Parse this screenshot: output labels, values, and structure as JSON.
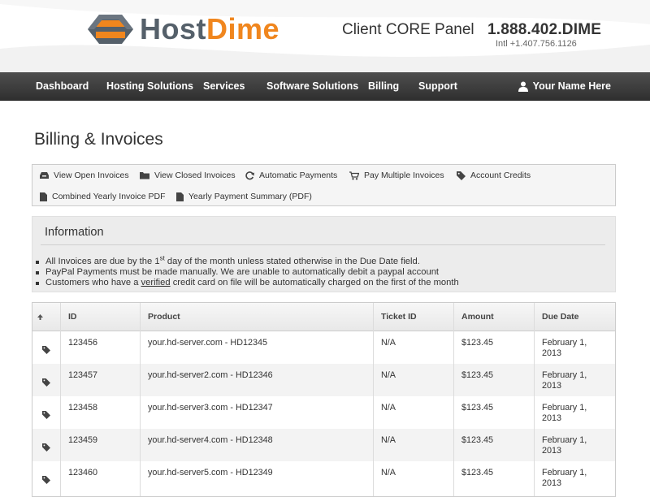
{
  "brand": {
    "name_part1": "Host",
    "name_part2": "Dime",
    "panel_title": "Client CORE Panel",
    "phone": "1.888.402.DIME",
    "phone_intl": "Intl +1.407.756.1126",
    "accent_color": "#f0861e",
    "logo_gray": "#55606a"
  },
  "nav": {
    "items": [
      {
        "label": "Dashboard"
      },
      {
        "label": "Hosting Solutions"
      },
      {
        "label": "Services"
      },
      {
        "label": "Software Solutions"
      },
      {
        "label": "Billing"
      },
      {
        "label": "Support"
      }
    ],
    "user_icon": "user-icon",
    "user_label": "Your Name Here"
  },
  "page": {
    "title": "Billing & Invoices"
  },
  "toolbar": {
    "links": [
      {
        "label": "View Open Invoices",
        "icon": "inbox-icon"
      },
      {
        "label": "View Closed Invoices",
        "icon": "folder-icon"
      },
      {
        "label": "Automatic Payments",
        "icon": "refresh-icon"
      },
      {
        "label": "Pay Multiple Invoices",
        "icon": "cart-icon"
      },
      {
        "label": "Account Credits",
        "icon": "tag-icon"
      },
      {
        "label": "Combined Yearly Invoice PDF",
        "icon": "document-icon"
      },
      {
        "label": "Yearly Payment Summary (PDF)",
        "icon": "document-icon"
      }
    ]
  },
  "info": {
    "title": "Information",
    "line1_pre": "All Invoices are due by the 1",
    "line1_sup": "st",
    "line1_post": " day of the month unless stated otherwise in the Due Date field.",
    "line2": "PayPal Payments must be made manually. We are unable to automatically debit a paypal account",
    "line3_pre": "Customers who have a ",
    "line3_link": "verified",
    "line3_post": " credit card on file will be automatically charged on the first of the month"
  },
  "table": {
    "sort_icon": "sort-arrow-icon",
    "headers": {
      "id": "ID",
      "product": "Product",
      "ticket": "Ticket ID",
      "amount": "Amount",
      "due": "Due Date"
    },
    "rows": [
      {
        "id": "123456",
        "product": "your.hd-server.com - HD12345",
        "ticket": "N/A",
        "amount": "$123.45",
        "due1": "February 1,",
        "due2": "2013"
      },
      {
        "id": "123457",
        "product": "your.hd-server2.com - HD12346",
        "ticket": "N/A",
        "amount": "$123.45",
        "due1": "February 1,",
        "due2": "2013"
      },
      {
        "id": "123458",
        "product": "your.hd-server3.com - HD12347",
        "ticket": "N/A",
        "amount": "$123.45",
        "due1": "February 1,",
        "due2": "2013"
      },
      {
        "id": "123459",
        "product": "your.hd-server4.com - HD12348",
        "ticket": "N/A",
        "amount": "$123.45",
        "due1": "February 1,",
        "due2": "2013"
      },
      {
        "id": "123460",
        "product": "your.hd-server5.com - HD12349",
        "ticket": "N/A",
        "amount": "$123.45",
        "due1": "February 1,",
        "due2": "2013"
      }
    ]
  }
}
